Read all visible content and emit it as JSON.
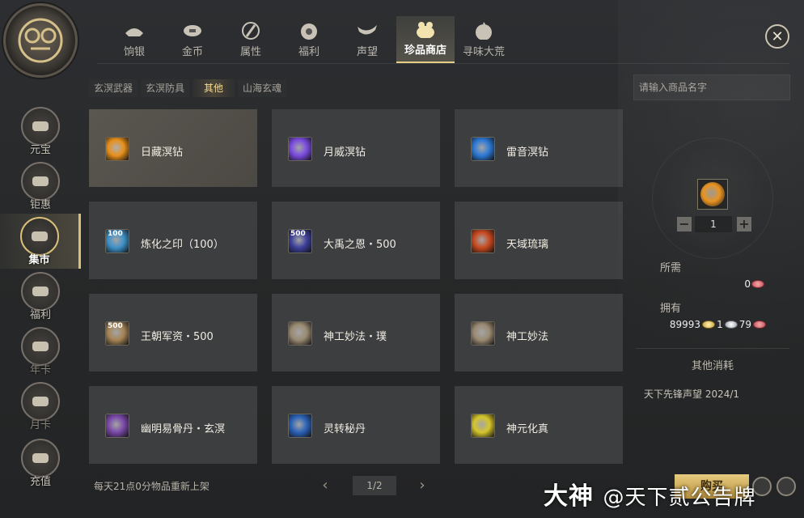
{
  "top_tabs": [
    {
      "label": "饷银",
      "icon": "silver-ingot-icon"
    },
    {
      "label": "金币",
      "icon": "gold-coin-icon"
    },
    {
      "label": "属性",
      "icon": "attribute-brush-icon"
    },
    {
      "label": "福利",
      "icon": "welfare-bag-icon"
    },
    {
      "label": "声望",
      "icon": "reputation-scroll-icon"
    },
    {
      "label": "珍品商店",
      "icon": "treasure-pot-icon"
    },
    {
      "label": "寻味大荒",
      "icon": "fruit-basket-icon"
    }
  ],
  "active_top_tab": 5,
  "left_nav": [
    {
      "label": "元宝",
      "icon": "yuanbao-ingot-icon"
    },
    {
      "label": "钜惠",
      "icon": "discount-box-icon"
    },
    {
      "label": "集市",
      "icon": "market-coin-icon"
    },
    {
      "label": "福利",
      "icon": "welfare-pouch-icon"
    },
    {
      "label": "年卡",
      "icon": "year-card-icon"
    },
    {
      "label": "月卡",
      "icon": "month-card-icon"
    },
    {
      "label": "充值",
      "icon": "recharge-coins-icon"
    }
  ],
  "active_left_nav": 2,
  "sub_tabs": [
    "玄溟武器",
    "玄溟防具",
    "其他",
    "山海玄魂"
  ],
  "active_sub_tab": 2,
  "items": [
    {
      "name": "日藏溟钻",
      "icon_color": "#e8901a",
      "badge": ""
    },
    {
      "name": "月威溟钻",
      "icon_color": "#7b4be0",
      "badge": ""
    },
    {
      "name": "雷音溟钻",
      "icon_color": "#2c79d6",
      "badge": ""
    },
    {
      "name": "炼化之印（100）",
      "icon_color": "#3d90c9",
      "badge": "100"
    },
    {
      "name": "大禹之恩・500",
      "icon_color": "#3c3f9a",
      "badge": "500"
    },
    {
      "name": "天域琉璃",
      "icon_color": "#c8481e",
      "badge": ""
    },
    {
      "name": "王朝军资・500",
      "icon_color": "#a68455",
      "badge": "500"
    },
    {
      "name": "神工妙法・璞",
      "icon_color": "#9a8a72",
      "badge": ""
    },
    {
      "name": "神工妙法",
      "icon_color": "#9a8a72",
      "badge": ""
    },
    {
      "name": "幽明易骨丹・玄溟",
      "icon_color": "#7a48a8",
      "badge": ""
    },
    {
      "name": "灵转秘丹",
      "icon_color": "#2a62b8",
      "badge": ""
    },
    {
      "name": "神元化真",
      "icon_color": "#d6c62a",
      "badge": ""
    }
  ],
  "selected_item": 0,
  "footer": {
    "refresh_note": "每天21点0分物品重新上架",
    "page": "1/2"
  },
  "search": {
    "placeholder": "请输入商品名字"
  },
  "purchase": {
    "quantity": "1",
    "need_label": "所需",
    "need_value": "0",
    "own_label": "拥有",
    "own_gold": "89993",
    "own_silver": "1",
    "own_pink": "79",
    "other_title": "其他消耗",
    "other_line": "天下先锋声望  2024/1",
    "buy_label": "购买"
  },
  "close_label": "✕",
  "watermark": {
    "brand": "大神",
    "account": "@天下贰公告牌"
  }
}
